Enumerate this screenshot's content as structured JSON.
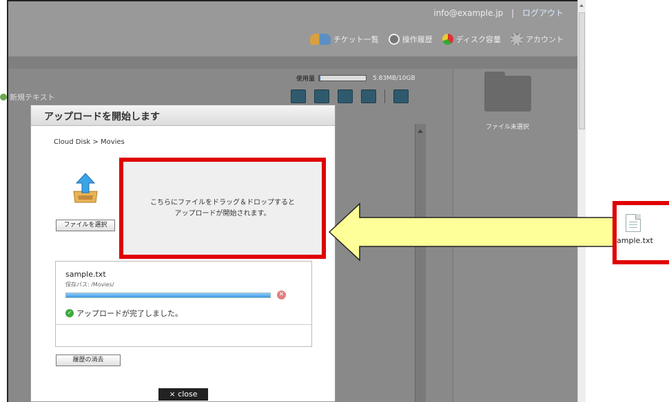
{
  "header": {
    "email": "info@example.jp",
    "separator": "|",
    "logout": "ログアウト",
    "nav": [
      {
        "label": "チケット一覧",
        "icon": "users-icon"
      },
      {
        "label": "操作履歴",
        "icon": "clock-icon"
      },
      {
        "label": "ディスク容量",
        "icon": "pie-chart-icon"
      },
      {
        "label": "アカウント",
        "icon": "gear-icon"
      }
    ]
  },
  "usage": {
    "label": "使用量",
    "text": "5.83MB/10GB",
    "fill_fraction": 0.03
  },
  "toolbar": {
    "new_text": "新規テキスト"
  },
  "preview": {
    "no_file": "ファイル未選択"
  },
  "modal": {
    "title": "アップロードを開始します",
    "breadcrumb": "Cloud Disk > Movies",
    "select_button": "ファイルを選択",
    "drop_text": "こちらにファイルをドラッグ＆ドロップすると\nアップロードが開始されます。",
    "item": {
      "name": "sample.txt",
      "path": "保存パス: /Movies/",
      "progress": 1.0,
      "status": "アップロードが完了しました。"
    },
    "clear_button": "履歴の消去",
    "close_button": "× close"
  },
  "desktop": {
    "file_label": "ample.txt"
  },
  "colors": {
    "highlight_red": "#e00000",
    "arrow_yellow": "#ffff99",
    "progress_blue": "#3a98e0"
  }
}
